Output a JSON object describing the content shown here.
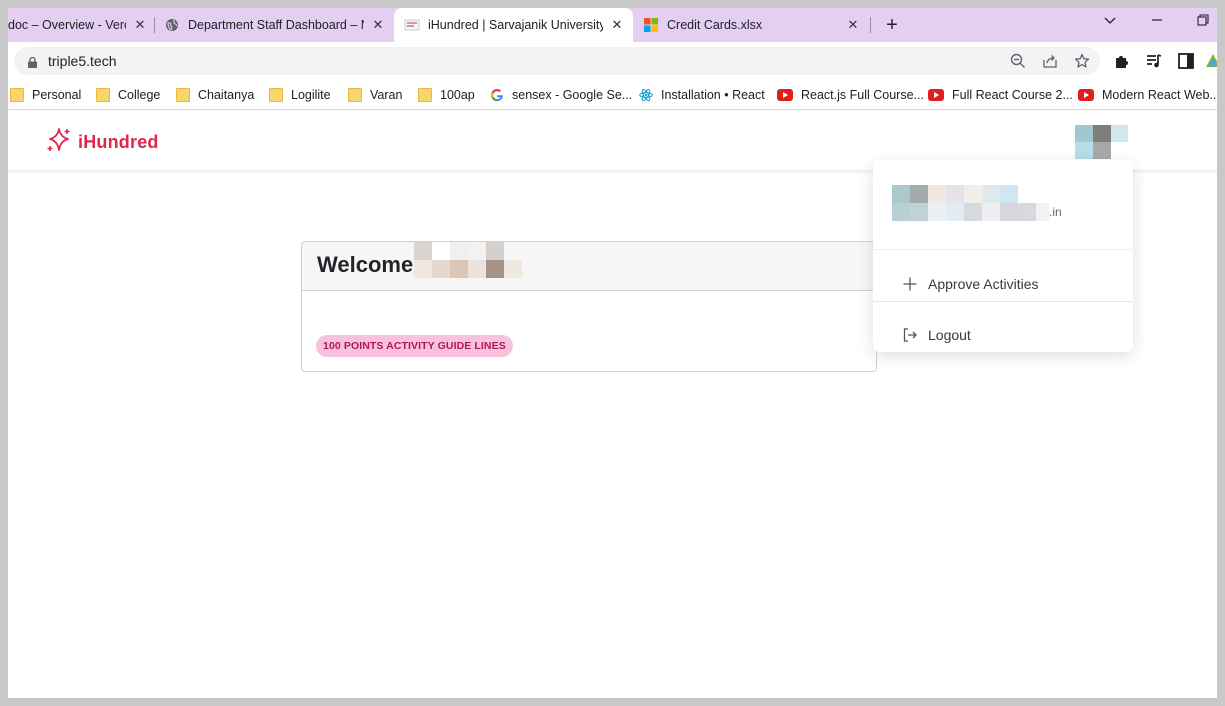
{
  "browser": {
    "tabs": [
      {
        "title": "doc – Overview - Vercel",
        "active": false
      },
      {
        "title": "Department Staff Dashboard – Next.js",
        "active": false
      },
      {
        "title": "iHundred | Sarvajanik University",
        "active": true
      },
      {
        "title": "Credit Cards.xlsx",
        "active": false
      }
    ],
    "new_tab_label": "+",
    "url": "triple5.tech",
    "bookmarks": [
      {
        "label": "Personal",
        "icon": "folder-icon"
      },
      {
        "label": "College",
        "icon": "folder-icon"
      },
      {
        "label": "Chaitanya",
        "icon": "folder-icon"
      },
      {
        "label": "Logilite",
        "icon": "folder-icon"
      },
      {
        "label": "Varan",
        "icon": "folder-icon"
      },
      {
        "label": "100ap",
        "icon": "folder-icon"
      },
      {
        "label": "sensex - Google Se...",
        "icon": "google-icon"
      },
      {
        "label": "Installation • React",
        "icon": "react-icon"
      },
      {
        "label": "React.js Full Course...",
        "icon": "youtube-icon"
      },
      {
        "label": "Full React Course 2...",
        "icon": "youtube-icon"
      },
      {
        "label": "Modern React Web...",
        "icon": "youtube-icon"
      }
    ]
  },
  "app": {
    "brand": "iHundred",
    "accent_color": "#e0254f",
    "welcome": "Welcome",
    "guideline_pill": "100 POINTS ACTIVITY GUIDE LINES",
    "user_menu": {
      "email_suffix": ".in",
      "items": [
        {
          "label": "Approve Activities",
          "icon": "plus-icon"
        },
        {
          "label": "Logout",
          "icon": "logout-icon"
        }
      ]
    }
  }
}
